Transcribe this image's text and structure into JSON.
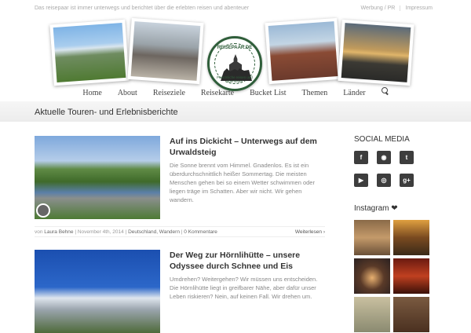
{
  "topbar": {
    "tagline": "Das reisepaar ist immer unterwegs und berichtet über die erlebten reisen und abenteuer",
    "links": [
      "Werbung / PR",
      "Impressum"
    ]
  },
  "logo": {
    "title": "REISEPAAR.DE",
    "subtitle": "Persönliche reisen und abenteuer"
  },
  "nav": {
    "items": [
      "Home",
      "About",
      "Reiseziele",
      "Reisekarte",
      "Bucket List",
      "Themen",
      "Länder"
    ]
  },
  "page": {
    "title": "Aktuelle Touren- und Erlebnisberichte"
  },
  "posts": [
    {
      "title": "Auf ins Dickicht – Unterwegs auf dem Urwaldsteig",
      "excerpt": "Die Sonne brennt vom Himmel. Gnadenlos. Es ist ein überdurchschnittlich heißer Sommertag. Die meisten Menschen gehen bei so einem Wetter schwimmen oder liegen träge im Schatten. Aber wir nicht. Wir gehen wandern.",
      "meta_prefix": "von",
      "author": "Laura Behne",
      "date": "November 4th, 2014",
      "categories": "Deutschland, Wandern",
      "comments": "0 Kommentare",
      "more": "Weiterlesen ›"
    },
    {
      "title": "Der Weg zur Hörnlihütte – unsere Odyssee durch Schnee und Eis",
      "excerpt": "Umdrehen? Weitergehen? Wir müssen uns entscheiden. Die Hörnlihütte liegt in greifbarer Nähe, aber dafür unser Leben riskieren? Nein, auf keinen Fall. Wir drehen um."
    }
  ],
  "sidebar": {
    "social_title": "SOCIAL MEDIA",
    "social_icons": [
      "f",
      "rss",
      "t",
      "yt",
      "ig",
      "g+"
    ],
    "instagram_title": "Instagram ❤"
  }
}
